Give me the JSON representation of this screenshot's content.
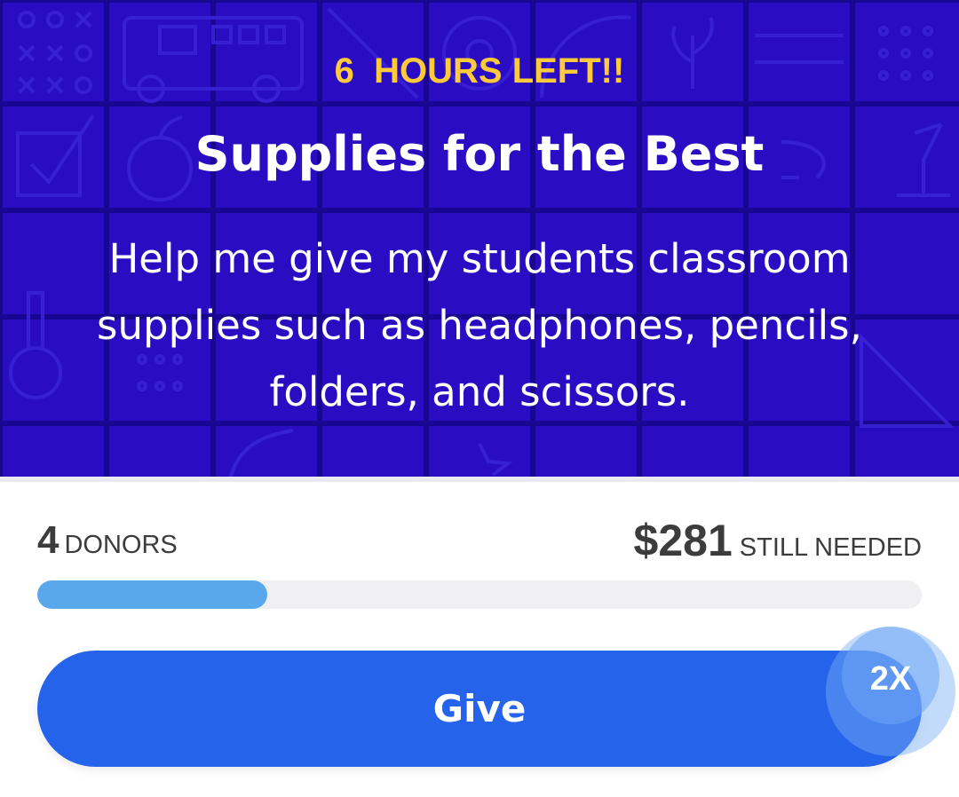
{
  "campaign": {
    "deadline": "6  HOURS LEFT!!",
    "title": "Supplies for the Best",
    "description": "Help me give my students classroom supplies such as headphones, pencils, folders, and scissors."
  },
  "stats": {
    "donor_count": "4",
    "donor_label": "DONORS",
    "amount_needed": "$281",
    "needed_label": "STILL NEEDED",
    "progress_fraction": 0.26
  },
  "actions": {
    "give_label": "Give",
    "match_badge": "2X"
  },
  "colors": {
    "hero_bg": "#2a0dc2",
    "deadline": "#ffc93c",
    "progress_fill": "#5aa8ec",
    "button": "#2563eb"
  }
}
